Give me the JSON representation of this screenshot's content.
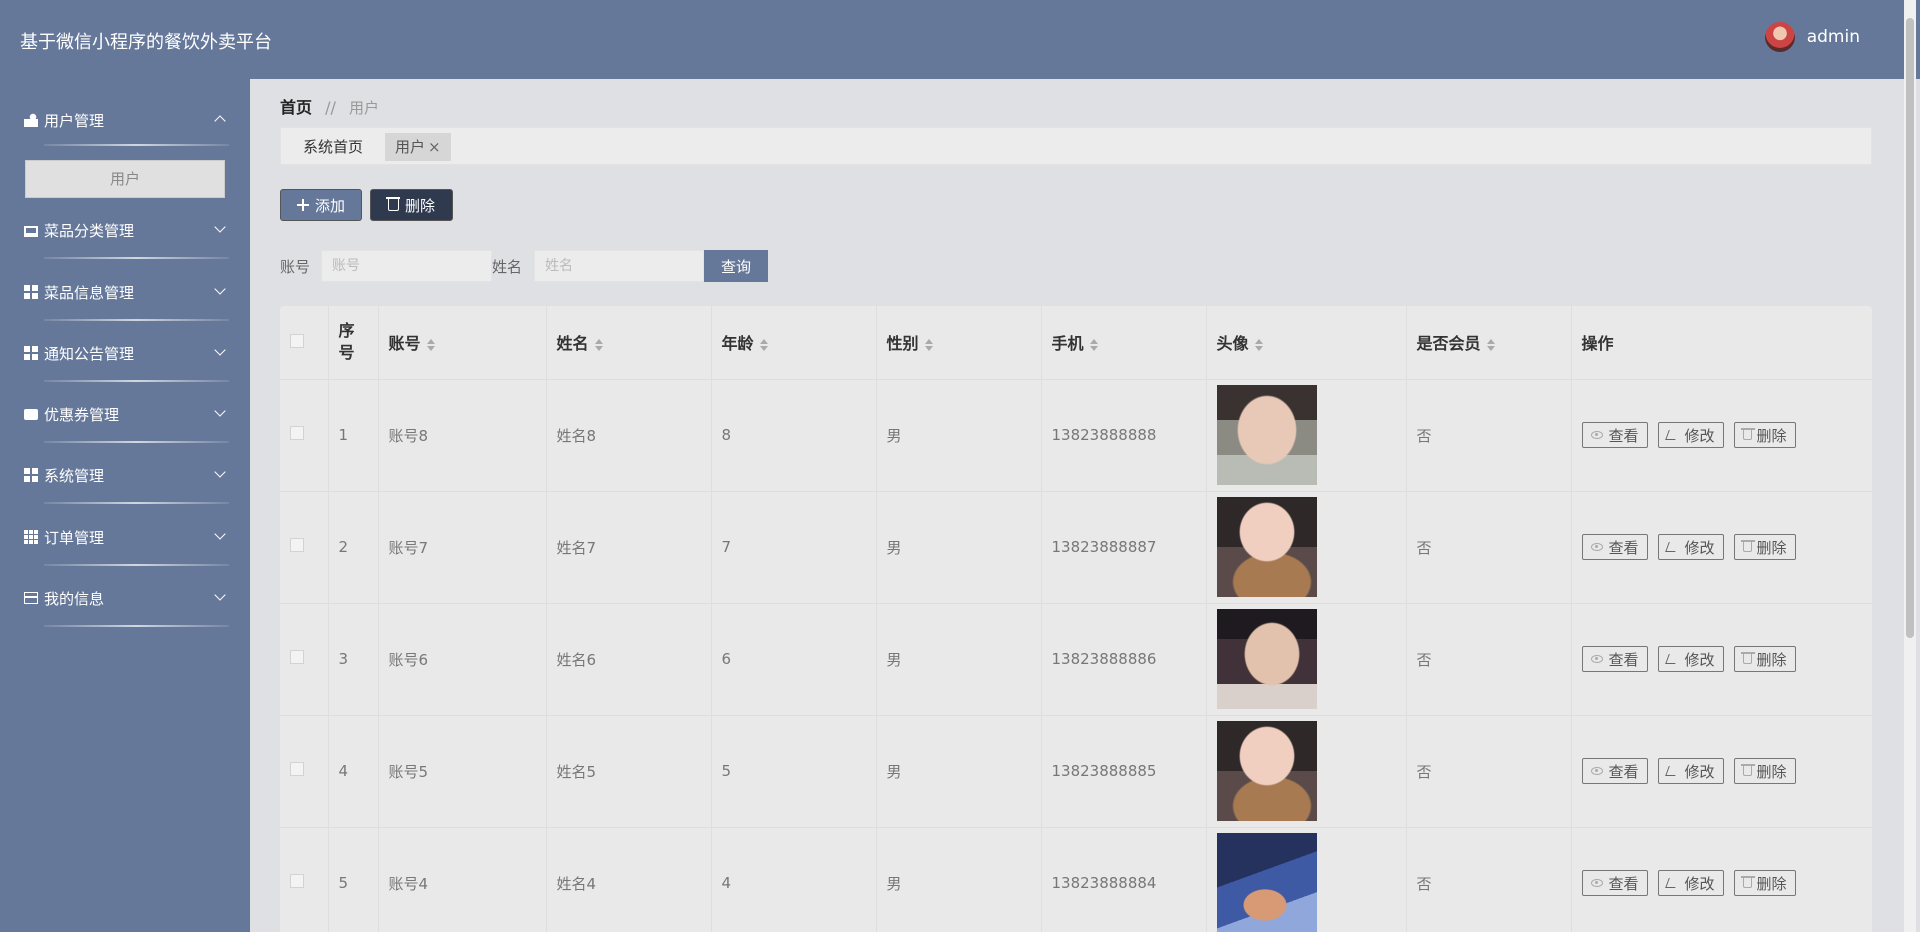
{
  "header": {
    "title": "基于微信小程序的餐饮外卖平台",
    "username": "admin"
  },
  "sidebar": {
    "items": [
      {
        "label": "用户管理",
        "icon": "users-icon",
        "expanded": true
      },
      {
        "label": "菜品分类管理",
        "icon": "monitor-icon"
      },
      {
        "label": "菜品信息管理",
        "icon": "grid-icon"
      },
      {
        "label": "通知公告管理",
        "icon": "grid-icon"
      },
      {
        "label": "优惠券管理",
        "icon": "ticket-icon"
      },
      {
        "label": "系统管理",
        "icon": "grid-icon"
      },
      {
        "label": "订单管理",
        "icon": "grid9-icon"
      },
      {
        "label": "我的信息",
        "icon": "card-icon"
      }
    ],
    "submenu": {
      "label": "用户"
    }
  },
  "breadcrumb": {
    "home": "首页",
    "separator": "//",
    "current": "用户"
  },
  "tabs": [
    {
      "label": "系统首页"
    },
    {
      "label": "用户",
      "close": "×"
    }
  ],
  "toolbar": {
    "add_label": "添加",
    "delete_label": "删除"
  },
  "search": {
    "account_label": "账号",
    "account_placeholder": "账号",
    "name_label": "姓名",
    "name_placeholder": "姓名",
    "query_label": "查询"
  },
  "table": {
    "headers": {
      "index": "序号",
      "account": "账号",
      "name": "姓名",
      "age": "年龄",
      "gender": "性别",
      "phone": "手机",
      "avatar": "头像",
      "member": "是否会员",
      "actions": "操作"
    },
    "rows": [
      {
        "index": "1",
        "account": "账号8",
        "name": "姓名8",
        "age": "8",
        "gender": "男",
        "phone": "13823888888",
        "member": "否",
        "avatar_style": "p1"
      },
      {
        "index": "2",
        "account": "账号7",
        "name": "姓名7",
        "age": "7",
        "gender": "男",
        "phone": "13823888887",
        "member": "否",
        "avatar_style": "p2"
      },
      {
        "index": "3",
        "account": "账号6",
        "name": "姓名6",
        "age": "6",
        "gender": "男",
        "phone": "13823888886",
        "member": "否",
        "avatar_style": "p3"
      },
      {
        "index": "4",
        "account": "账号5",
        "name": "姓名5",
        "age": "5",
        "gender": "男",
        "phone": "13823888885",
        "member": "否",
        "avatar_style": "p2"
      },
      {
        "index": "5",
        "account": "账号4",
        "name": "姓名4",
        "age": "4",
        "gender": "男",
        "phone": "13823888884",
        "member": "否",
        "avatar_style": "p4"
      }
    ],
    "actions": {
      "view": "查看",
      "edit": "修改",
      "delete": "删除"
    }
  },
  "colors": {
    "primary": "#66789a",
    "dark_button": "#2f3a4e",
    "background": "#dfe0e3"
  }
}
